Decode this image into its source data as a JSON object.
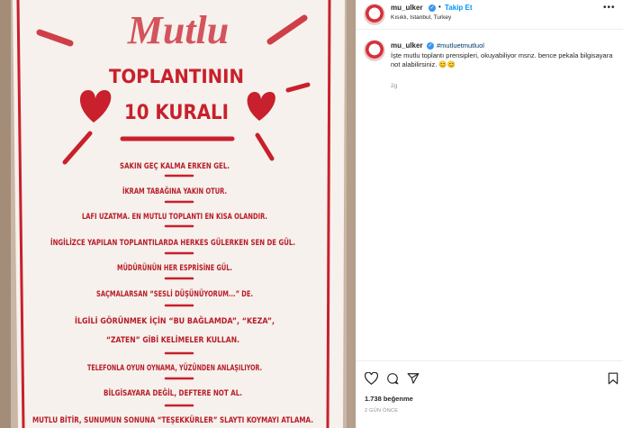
{
  "post": {
    "username": "mu_ulker",
    "separator": "•",
    "follow_label": "Takip Et",
    "location": "Kısıklı, Istanbul, Turkey",
    "caption": {
      "username": "mu_ulker",
      "hashtag": "#mutluetmutluol",
      "text": "İşte mutlu toplantı prensipleri, okuyabiliyor msnz. bence pekala bilgisayara not alabilirsiniz. 😊😊",
      "time": "2g"
    },
    "likes": "1.738 beğenme",
    "date": "2 GÜN ÖNCE"
  },
  "poster": {
    "logo": "Mutlu",
    "title_line1": "TOPLANTININ",
    "title_line2": "10 KURALI",
    "rules": [
      "SAKIN GEÇ KALMA ERKEN GEL.",
      "İKRAM TABAĞINA YAKIN OTUR.",
      "LAFI UZATMA. EN MUTLU TOPLANTI EN KISA OLANDIR.",
      "İNGİLİZCE YAPILAN TOPLANTILARDA HERKES GÜLERKEN SEN DE GÜL.",
      "MÜDÜRÜNÜN HER ESPRİSİNE GÜL.",
      "SAÇMALARSAN “SESLİ DÜŞÜNÜYORUM...” DE.",
      "İLGİLİ GÖRÜNMEK İÇİN “BU BAĞLAMDA”, “KEZA”,",
      "“ZATEN” GİBİ KELİMELER KULLAN.",
      "TELEFONLA OYUN OYNAMA, YÜZÜNDEN ANLAŞILIYOR.",
      "BİLGİSAYARA DEĞİL, DEFTERE NOT AL.",
      "MUTLU BİTİR, SUNUMUN SONUNA “TEŞEKKÜRLER” SLAYTI KOYMAYI ATLAMA."
    ]
  },
  "colors": {
    "poster_red": "#c8202c",
    "link_blue": "#0095f6",
    "verified_blue": "#3897f0"
  },
  "icons": [
    "heart-icon",
    "comment-icon",
    "share-icon",
    "bookmark-icon",
    "more-icon",
    "verified-icon"
  ]
}
